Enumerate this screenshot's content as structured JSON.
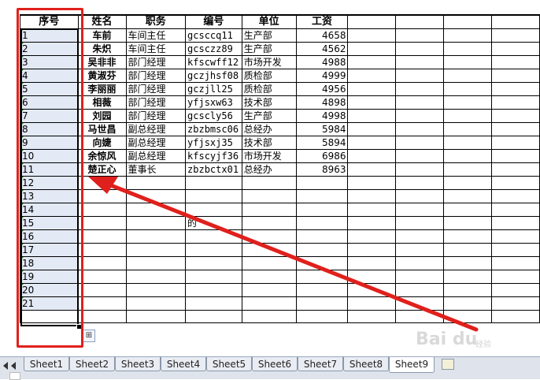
{
  "headers": [
    "序号",
    "姓名",
    "职务",
    "编号",
    "单位",
    "工资",
    "",
    "",
    "",
    ""
  ],
  "rows": [
    [
      "1",
      "车前",
      "车间主任",
      "gcsccq11",
      "生产部",
      "4658"
    ],
    [
      "2",
      "朱炽",
      "车间主任",
      "gcsczz89",
      "生产部",
      "4562"
    ],
    [
      "3",
      "吴非非",
      "部门经理",
      "kfscwff12",
      "市场开发",
      "4988"
    ],
    [
      "4",
      "黄淑芬",
      "部门经理",
      "gczjhsf08",
      "质检部",
      "4999"
    ],
    [
      "5",
      "李丽丽",
      "部门经理",
      "gczjll25",
      "质检部",
      "4956"
    ],
    [
      "6",
      "相薇",
      "部门经理",
      "yfjsxw63",
      "技术部",
      "4898"
    ],
    [
      "7",
      "刘园",
      "部门经理",
      "gcscly56",
      "生产部",
      "4998"
    ],
    [
      "8",
      "马世昌",
      "副总经理",
      "zbzbmsc06",
      "总经办",
      "5984"
    ],
    [
      "9",
      "向婕",
      "副总经理",
      "yfjsxj35",
      "技术部",
      "5894"
    ],
    [
      "10",
      "余惊风",
      "副总经理",
      "kfscyjf36",
      "市场开发",
      "6986"
    ],
    [
      "11",
      "楚正心",
      "董事长",
      "zbzbctx01",
      "总经办",
      "8963"
    ],
    [
      "12",
      "",
      "",
      "",
      "",
      ""
    ],
    [
      "13",
      "",
      "",
      "",
      "",
      ""
    ],
    [
      "14",
      "",
      "",
      "",
      "",
      ""
    ],
    [
      "15",
      "",
      "",
      "的",
      "",
      ""
    ],
    [
      "16",
      "",
      "",
      "",
      "",
      ""
    ],
    [
      "17",
      "",
      "",
      "",
      "",
      ""
    ],
    [
      "18",
      "",
      "",
      "",
      "",
      ""
    ],
    [
      "19",
      "",
      "",
      "",
      "",
      ""
    ],
    [
      "20",
      "",
      "",
      "",
      "",
      ""
    ],
    [
      "21",
      "",
      "",
      "",
      "",
      ""
    ],
    [
      "",
      "",
      "",
      "",
      "",
      ""
    ]
  ],
  "sheet_tabs": [
    "Sheet1",
    "Sheet2",
    "Sheet3",
    "Sheet4",
    "Sheet5",
    "Sheet6",
    "Sheet7",
    "Sheet8",
    "Sheet9"
  ],
  "active_sheet": "Sheet9",
  "watermark": {
    "brand": "Bai du",
    "sub": "经验"
  },
  "annotation": {
    "box_color": "#e0201c",
    "arrow_color": "#e0201c"
  },
  "selection_color": "#e3e9f5"
}
